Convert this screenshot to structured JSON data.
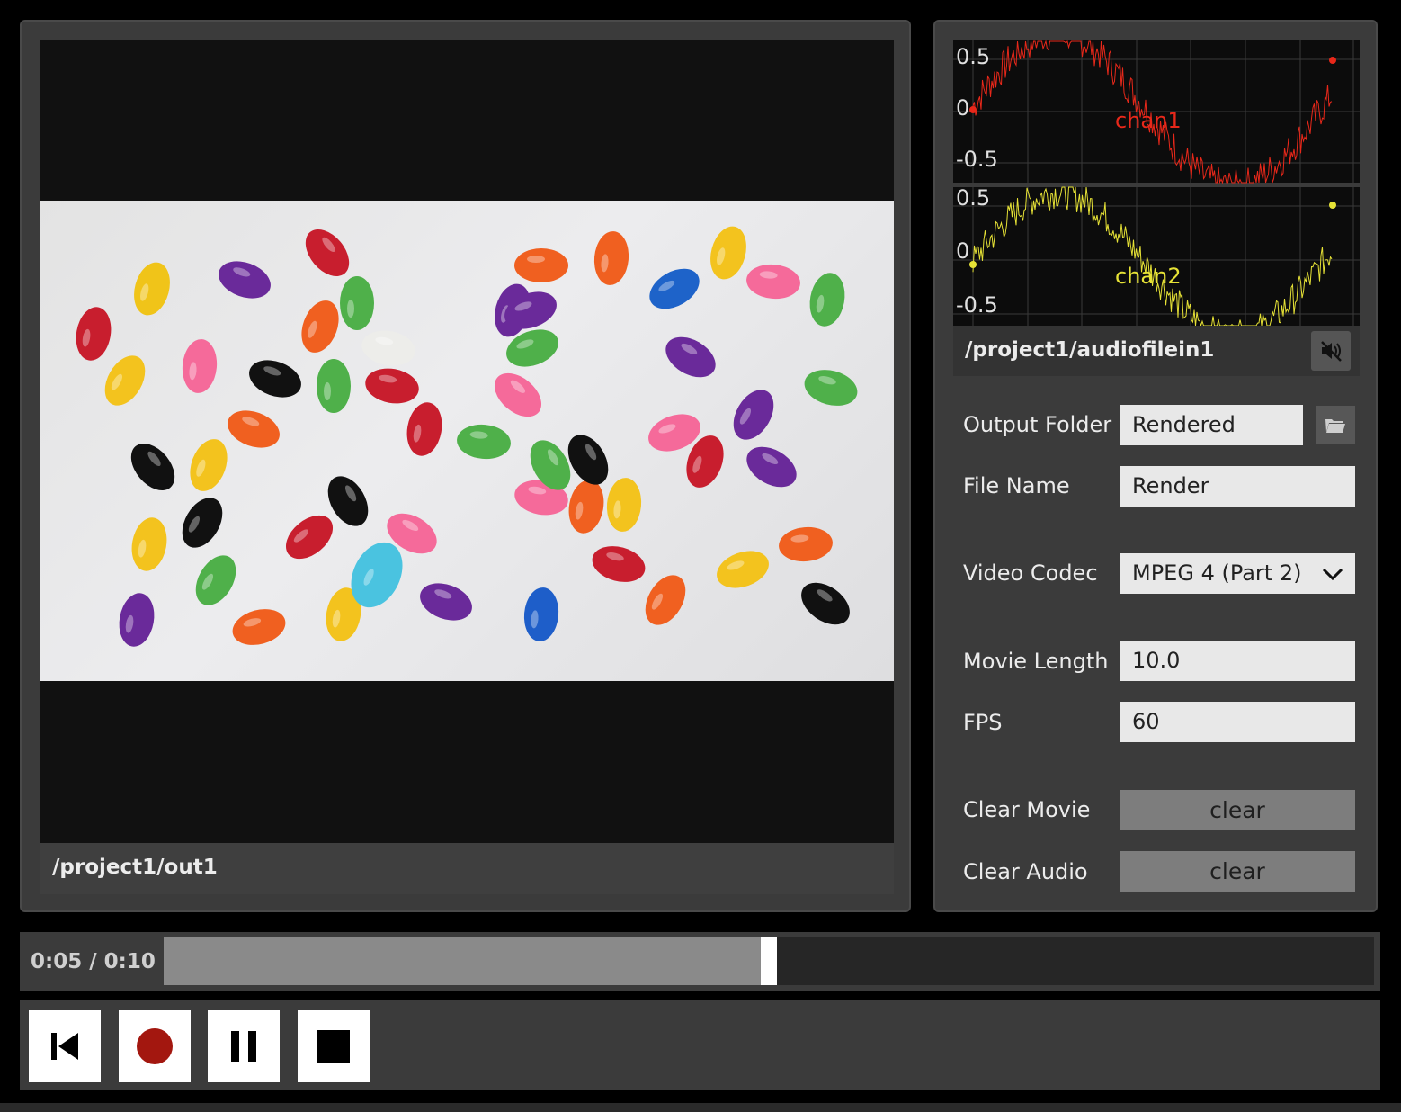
{
  "video": {
    "path": "/project1/out1"
  },
  "scope": {
    "ticks": [
      "0.5",
      "0",
      "-0.5"
    ],
    "channels": [
      {
        "name": "chan1",
        "color": "#e8281a"
      },
      {
        "name": "chan2",
        "color": "#e6e236"
      }
    ]
  },
  "audio": {
    "path": "/project1/audiofilein1",
    "mute_icon": "speaker-muted-icon"
  },
  "settings": {
    "output_folder": {
      "label": "Output Folder",
      "value": "Rendered",
      "icon": "folder-icon"
    },
    "file_name": {
      "label": "File Name",
      "value": "Render"
    },
    "video_codec": {
      "label": "Video Codec",
      "value": "MPEG 4 (Part 2)"
    },
    "movie_length": {
      "label": "Movie Length",
      "value": "10.0"
    },
    "fps": {
      "label": "FPS",
      "value": "60"
    },
    "clear_movie": {
      "label": "Clear Movie",
      "button": "clear"
    },
    "clear_audio": {
      "label": "Clear Audio",
      "button": "clear"
    }
  },
  "timeline": {
    "label": "0:05 / 0:10",
    "progress": 0.5
  },
  "controls": {
    "icons": [
      "skip-to-start-icon",
      "record-icon",
      "pause-icon",
      "stop-icon"
    ],
    "record_color": "#a3170f"
  }
}
